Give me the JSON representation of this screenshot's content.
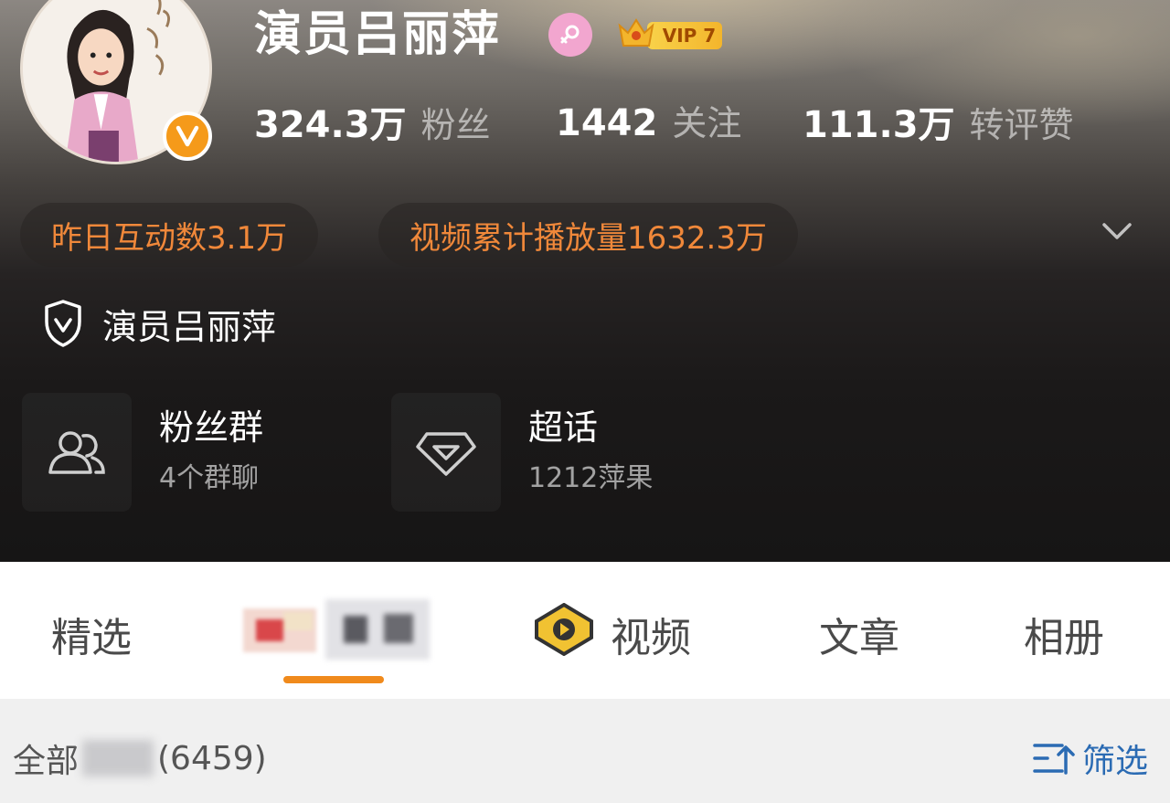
{
  "profile": {
    "name": "演员吕丽萍",
    "vip_label": "VIP 7",
    "icons": {
      "gender": "female-icon",
      "vip": "crown-icon",
      "verified": "verified-v-icon"
    }
  },
  "stats": [
    {
      "value": "324.3万",
      "label": "粉丝"
    },
    {
      "value": "1442",
      "label": "关注"
    },
    {
      "value": "111.3万",
      "label": "转评赞"
    }
  ],
  "highlights": [
    {
      "text": "昨日互动数3.1万"
    },
    {
      "text": "视频累计播放量1632.3万"
    }
  ],
  "verification": {
    "text": "演员吕丽萍"
  },
  "cards": [
    {
      "title": "粉丝群",
      "subtitle": "4个群聊",
      "icon": "users-icon"
    },
    {
      "title": "超话",
      "subtitle": "1212萍果",
      "icon": "diamond-icon"
    }
  ],
  "tabs": [
    {
      "label": "精选"
    },
    {
      "label": "视频"
    },
    {
      "label": "文章"
    },
    {
      "label": "相册"
    }
  ],
  "filter_bar": {
    "all_prefix": "全部",
    "count": "(6459)",
    "filter_label": "筛选"
  },
  "colors": {
    "accent": "#f08a1c",
    "highlight_text": "#f0883a",
    "link": "#2b6bb3"
  }
}
